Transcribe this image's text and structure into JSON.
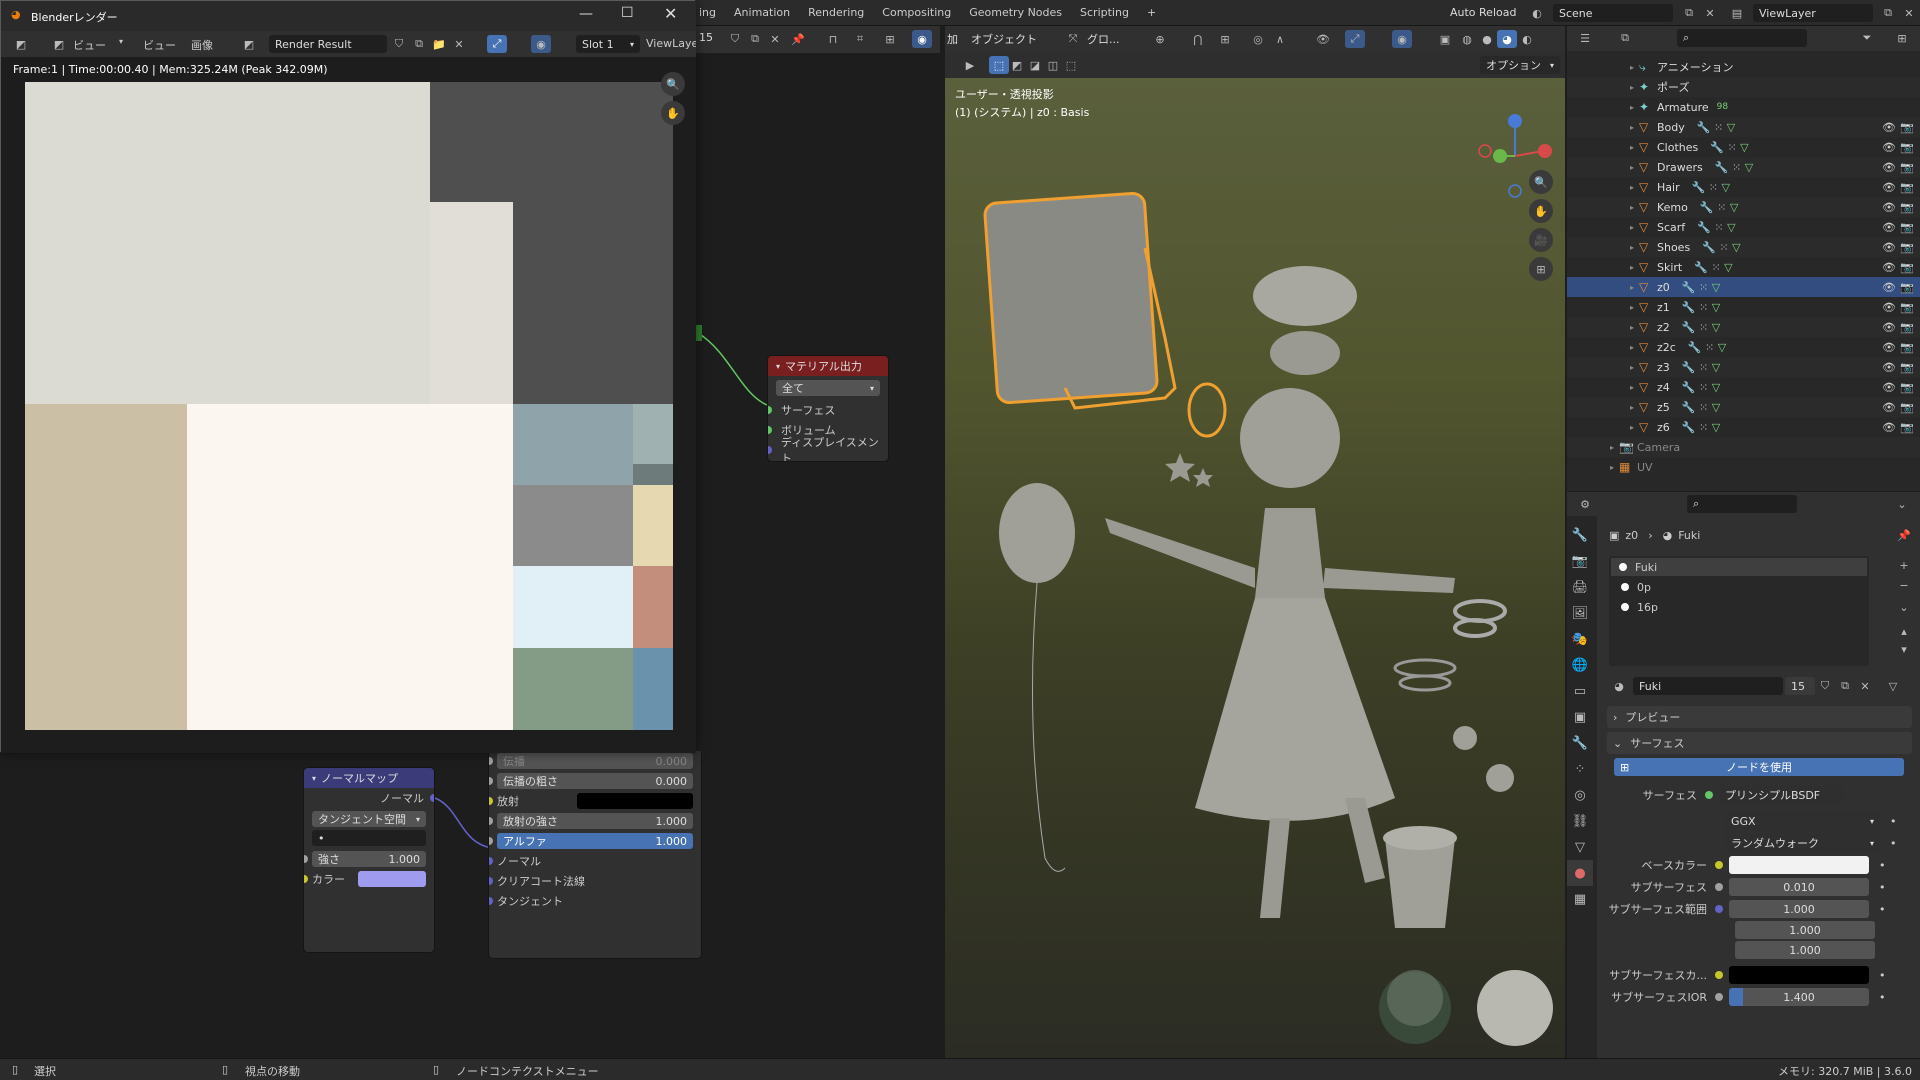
{
  "topbar": {
    "tabs": [
      "ing",
      "Animation",
      "Rendering",
      "Compositing",
      "Geometry Nodes",
      "Scripting",
      "+"
    ],
    "auto_reload": "Auto Reload",
    "scene": "Scene",
    "view_layer": "ViewLayer"
  },
  "render_window": {
    "title": "Blenderレンダー",
    "menu": [
      "ビュー",
      "ビュー",
      "画像"
    ],
    "image_name": "Render Result",
    "slot": "Slot 1",
    "view_layer": "ViewLaye",
    "info": "Frame:1 | Time:00:00.40 | Mem:325.24M (Peak 342.09M)",
    "swatches": [
      "#dcdbd3",
      "#4f4f4f",
      "#e1ded7",
      "#cbbfa5",
      "#fcf6f1",
      "#8ea3aa",
      "#6d7b7b",
      "#8b8b8b",
      "#e6d8b0",
      "#e0f0f6",
      "#c48e7d",
      "#849b85",
      "#6a92ad",
      "#9fb1b0"
    ]
  },
  "node_header": {
    "count": "15",
    "add": "加",
    "object": "オブジェクト",
    "global": "グロ..."
  },
  "nodes": {
    "material_output": {
      "title": "マテリアル出力",
      "target": "全て",
      "inputs": [
        "サーフェス",
        "ボリューム",
        "ディスプレイスメント"
      ]
    },
    "normal_map": {
      "title": "ノーマルマップ",
      "output": "ノーマル",
      "space": "タンジェント空間",
      "uv": "•",
      "strength_label": "強さ",
      "strength_value": "1.000",
      "color_label": "カラー"
    },
    "bsdf_partial": {
      "rows": [
        {
          "label": "伝播",
          "value": "0.000"
        },
        {
          "label": "伝播の粗さ",
          "value": "0.000"
        },
        {
          "label": "放射",
          "value": ""
        },
        {
          "label": "放射の強さ",
          "value": "1.000"
        },
        {
          "label": "アルファ",
          "value": "1.000"
        },
        {
          "label": "ノーマル",
          "value": ""
        },
        {
          "label": "クリアコート法線",
          "value": ""
        },
        {
          "label": "タンジェント",
          "value": ""
        }
      ]
    }
  },
  "viewport": {
    "options": "オプション",
    "view_name": "ユーザー・透視投影",
    "collection": "(1) (システム) | z0 : Basis"
  },
  "outliner": {
    "items": [
      {
        "name": "アニメーション",
        "type": "anim",
        "active": false
      },
      {
        "name": "ポーズ",
        "type": "pose",
        "active": false
      },
      {
        "name": "Armature",
        "type": "arm",
        "active": false
      },
      {
        "name": "Body",
        "type": "mesh",
        "active": false
      },
      {
        "name": "Clothes",
        "type": "mesh",
        "active": false
      },
      {
        "name": "Drawers",
        "type": "mesh",
        "active": false
      },
      {
        "name": "Hair",
        "type": "mesh",
        "active": false
      },
      {
        "name": "Kemo",
        "type": "mesh",
        "active": false
      },
      {
        "name": "Scarf",
        "type": "mesh",
        "active": false
      },
      {
        "name": "Shoes",
        "type": "mesh",
        "active": false
      },
      {
        "name": "Skirt",
        "type": "mesh",
        "active": false
      },
      {
        "name": "z0",
        "type": "mesh",
        "active": true
      },
      {
        "name": "z1",
        "type": "mesh",
        "active": false
      },
      {
        "name": "z2",
        "type": "mesh",
        "active": false
      },
      {
        "name": "z2c",
        "type": "mesh",
        "active": false
      },
      {
        "name": "z3",
        "type": "mesh",
        "active": false
      },
      {
        "name": "z4",
        "type": "mesh",
        "active": false
      },
      {
        "name": "z5",
        "type": "mesh",
        "active": false
      },
      {
        "name": "z6",
        "type": "mesh",
        "active": false
      },
      {
        "name": "Camera",
        "type": "cam",
        "active": false
      },
      {
        "name": "UV",
        "type": "uv",
        "active": false
      }
    ],
    "armature_badge": "98"
  },
  "properties": {
    "breadcrumb_obj": "z0",
    "breadcrumb_mat": "Fuki",
    "slots": [
      "Fuki",
      "0p",
      "16p"
    ],
    "material_name": "Fuki",
    "users": "15",
    "preview": "プレビュー",
    "surface_section": "サーフェス",
    "use_nodes": "ノードを使用",
    "surface_label": "サーフェス",
    "surface_value": "プリンシプルBSDF",
    "distribution": "GGX",
    "sss_method": "ランダムウォーク",
    "base_color_label": "ベースカラー",
    "subsurface_label": "サブサーフェス",
    "subsurface_value": "0.010",
    "radius_label": "サブサーフェス範囲",
    "radius_values": [
      "1.000",
      "1.000",
      "1.000"
    ],
    "sss_color_label": "サブサーフェスカ...",
    "sss_ior_label": "サブサーフェスIOR",
    "sss_ior_value": "1.400"
  },
  "statusbar": {
    "select": "選択",
    "move_view": "視点の移動",
    "node_menu": "ノードコンテクストメニュー",
    "memory": "メモリ: 320.7 MiB | 3.6.0"
  }
}
